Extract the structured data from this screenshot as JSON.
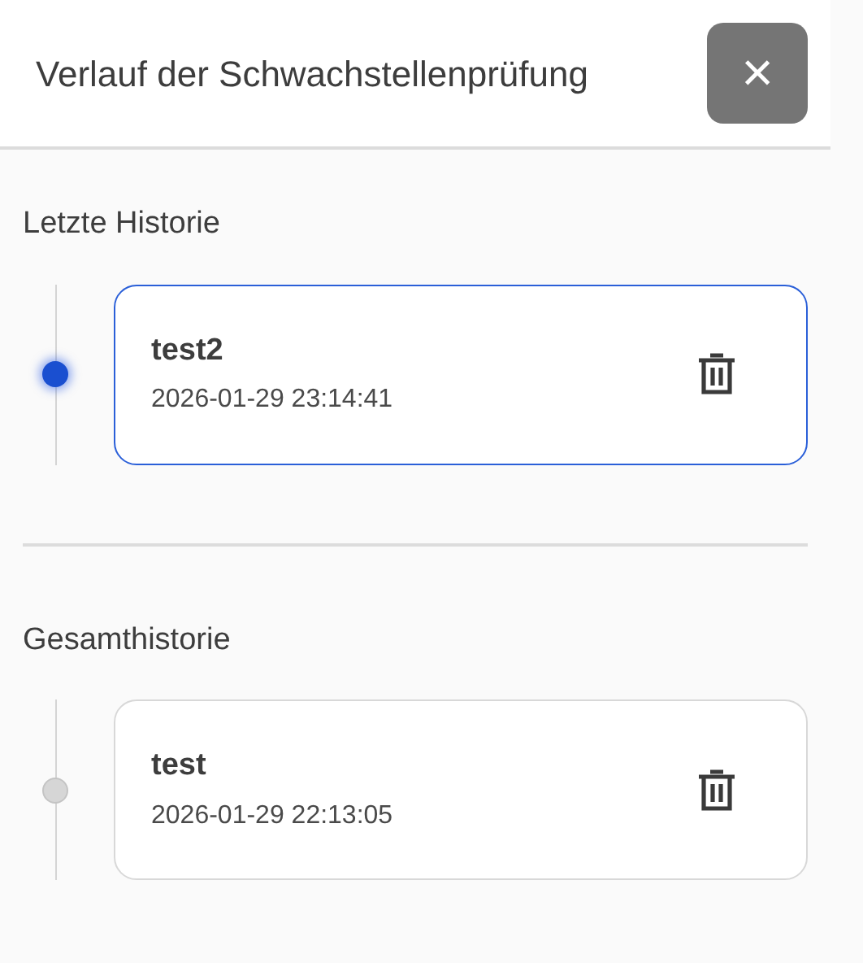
{
  "header": {
    "title": "Verlauf der Schwachstellenprüfung",
    "close_label": "×"
  },
  "sections": [
    {
      "title": "Letzte Historie",
      "items": [
        {
          "name": "test2",
          "timestamp": "2026-01-29 23:14:41",
          "selected": true
        }
      ]
    },
    {
      "title": "Gesamthistorie",
      "items": [
        {
          "name": "test",
          "timestamp": "2026-01-29 22:13:05",
          "selected": false
        }
      ]
    }
  ]
}
